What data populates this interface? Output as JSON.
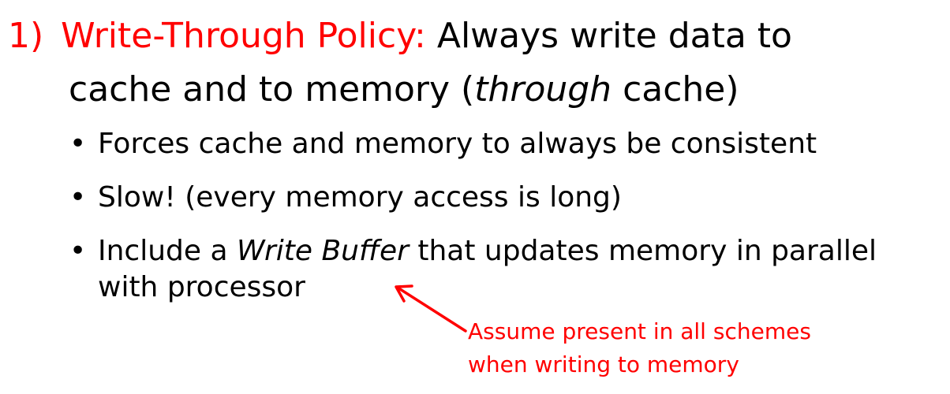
{
  "heading": {
    "number": "1)",
    "policy": "Write-Through Policy:",
    "desc_line1": "Always write data to",
    "desc_line2_pre": "cache and to memory (",
    "desc_line2_em": "through",
    "desc_line2_post": " cache)"
  },
  "bullets": {
    "b1": "Forces cache and memory to always be consistent",
    "b2": "Slow!  (every memory access is long)",
    "b3_pre": "Include a ",
    "b3_em": "Write Buffer",
    "b3_post": " that updates memory in parallel with processor"
  },
  "annotation": {
    "line1": "Assume present in all schemes",
    "line2": "when writing to memory"
  },
  "colors": {
    "accent": "#ff0000",
    "text": "#000000"
  }
}
